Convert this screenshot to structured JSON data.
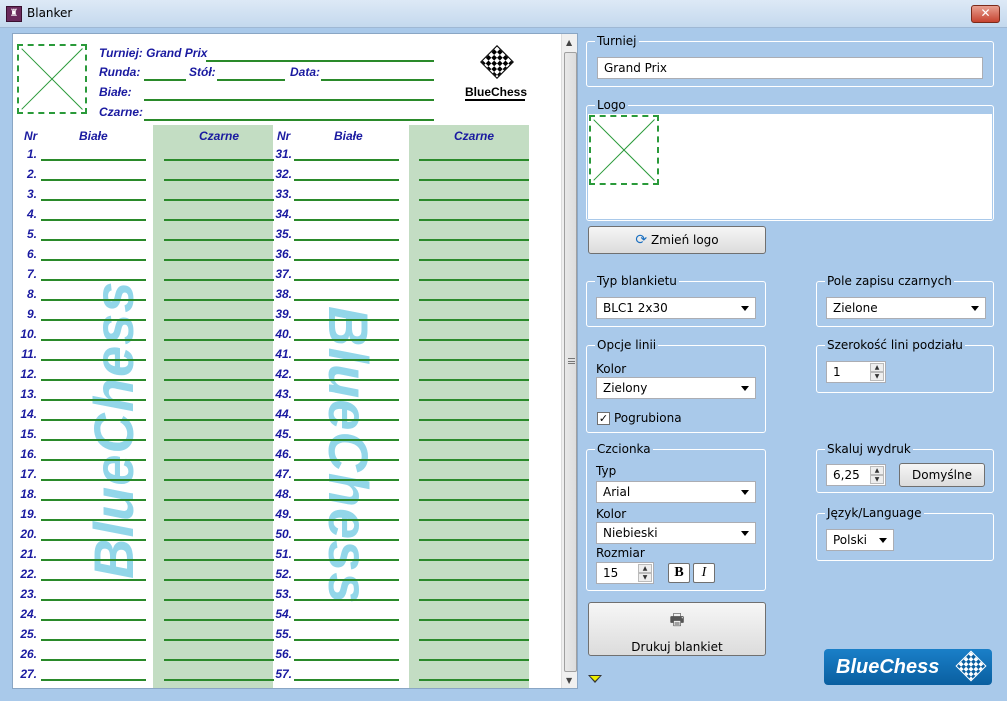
{
  "window": {
    "title": "Blanker",
    "close_label": "✕"
  },
  "sheet": {
    "tournament_line": "Turniej: Grand Prix",
    "runda_label": "Runda:",
    "stol_label": "Stół:",
    "data_label": "Data:",
    "biale_label": "Białe:",
    "czarne_label": "Czarne:",
    "col_nr": "Nr",
    "col_biale": "Białe",
    "col_czarne": "Czarne",
    "logo_text": "BlueChess",
    "watermark": "BlueChess",
    "left_rows": [
      "1.",
      "2.",
      "3.",
      "4.",
      "5.",
      "6.",
      "7.",
      "8.",
      "9.",
      "10.",
      "11.",
      "12.",
      "13.",
      "14.",
      "15.",
      "16.",
      "17.",
      "18.",
      "19.",
      "20.",
      "21.",
      "22.",
      "23.",
      "24.",
      "25.",
      "26.",
      "27."
    ],
    "right_rows": [
      "31.",
      "32.",
      "33.",
      "34.",
      "35.",
      "36.",
      "37.",
      "38.",
      "39.",
      "40.",
      "41.",
      "42.",
      "43.",
      "44.",
      "45.",
      "46.",
      "47.",
      "48.",
      "49.",
      "50.",
      "51.",
      "52.",
      "53.",
      "54.",
      "55.",
      "56.",
      "57."
    ]
  },
  "panel": {
    "turniej": {
      "legend": "Turniej",
      "value": "Grand Prix"
    },
    "logo": {
      "legend": "Logo",
      "change_button": "Zmień logo"
    },
    "typ_blankietu": {
      "legend": "Typ blankietu",
      "value": "BLC1 2x30"
    },
    "pole_zapisu": {
      "legend": "Pole zapisu czarnych",
      "value": "Zielone"
    },
    "opcje_linii": {
      "legend": "Opcje linii",
      "kolor_label": "Kolor",
      "kolor_value": "Zielony",
      "bold_label": "Pogrubiona",
      "bold_checked": true
    },
    "szerokosc": {
      "legend": "Szerokość lini podziału",
      "value": "1"
    },
    "czcionka": {
      "legend": "Czcionka",
      "typ_label": "Typ",
      "typ_value": "Arial",
      "kolor_label": "Kolor",
      "kolor_value": "Niebieski",
      "rozmiar_label": "Rozmiar",
      "rozmiar_value": "15",
      "bold_btn": "B",
      "italic_btn": "I"
    },
    "skaluj": {
      "legend": "Skaluj wydruk",
      "value": "6,25",
      "default_button": "Domyślne"
    },
    "jezyk": {
      "legend": "Język/Language",
      "value": "Polski"
    },
    "print_button": "Drukuj blankiet",
    "brand": "BlueChess"
  },
  "colors": {
    "ink": "#1a1aa0",
    "line": "#2a8a2a",
    "black_field": "#c3ddc3",
    "background": "#a9c9ea"
  }
}
